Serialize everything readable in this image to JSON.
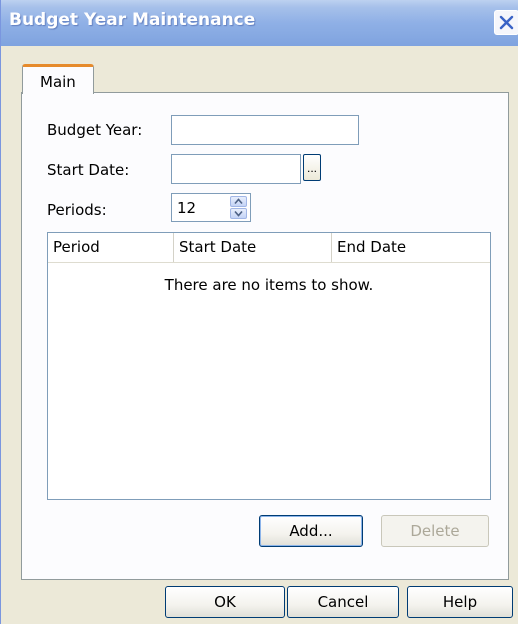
{
  "window": {
    "title": "Budget Year Maintenance"
  },
  "tabs": [
    {
      "label": "Main",
      "selected": true
    }
  ],
  "form": {
    "budget_year": {
      "label": "Budget Year:",
      "value": ""
    },
    "start_date": {
      "label": "Start Date:",
      "value": "",
      "browse_label": "..."
    },
    "periods": {
      "label": "Periods:",
      "value": "12"
    }
  },
  "periods_list": {
    "columns": [
      "Period",
      "Start Date",
      "End Date"
    ],
    "rows": [],
    "empty_message": "There are no items to show."
  },
  "list_buttons": {
    "add_label": "Add...",
    "delete_label": "Delete"
  },
  "dialog_buttons": {
    "ok_label": "OK",
    "cancel_label": "Cancel",
    "help_label": "Help"
  },
  "colors": {
    "titlebar": "#8fb0e6",
    "dialog_face": "#ece9d8",
    "tab_accent": "#e68b2c",
    "control_border": "#7f9db9",
    "button_border": "#003c74"
  },
  "icons": {
    "close": "close-icon",
    "spin_up": "arrow-up-icon",
    "spin_down": "arrow-down-icon"
  }
}
